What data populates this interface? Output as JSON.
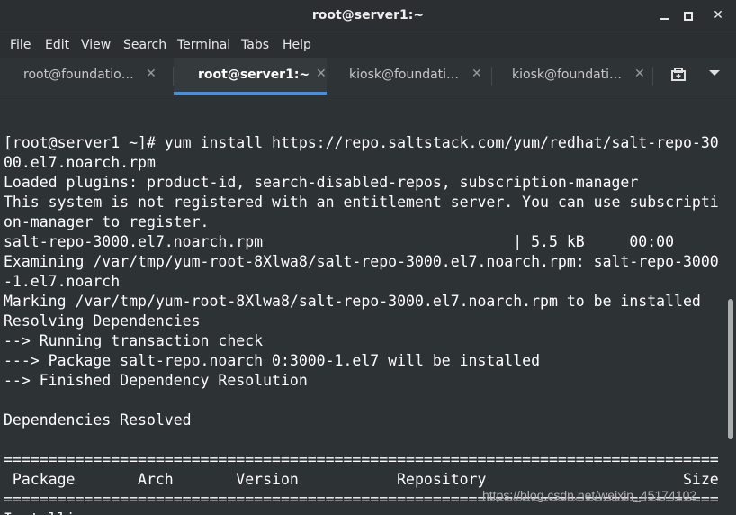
{
  "window": {
    "title": "root@server1:~",
    "controls": {
      "minimize_icon": "minimize-icon",
      "maximize_icon": "maximize-icon",
      "close_icon": "close-icon",
      "close_glyph": "✕"
    }
  },
  "menu": [
    "File",
    "Edit",
    "View",
    "Search",
    "Terminal",
    "Tabs",
    "Help"
  ],
  "tabs": [
    {
      "label": "root@foundatio…",
      "close": "✕",
      "active": false
    },
    {
      "label": "root@server1:~",
      "close": "✕",
      "active": true
    },
    {
      "label": "kiosk@foundati…",
      "close": "✕",
      "active": false
    },
    {
      "label": "kiosk@foundati…",
      "close": "✕",
      "active": false
    }
  ],
  "tab_actions": {
    "new_tab_icon": "new-tab-icon",
    "dropdown_icon": "chevron-down-icon"
  },
  "terminal": {
    "lines": [
      "[root@server1 ~]# yum install https://repo.saltstack.com/yum/redhat/salt-repo-30",
      "00.el7.noarch.rpm",
      "Loaded plugins: product-id, search-disabled-repos, subscription-manager",
      "This system is not registered with an entitlement server. You can use subscripti",
      "on-manager to register.",
      "salt-repo-3000.el7.noarch.rpm                            | 5.5 kB     00:00",
      "Examining /var/tmp/yum-root-8Xlwa8/salt-repo-3000.el7.noarch.rpm: salt-repo-3000",
      "-1.el7.noarch",
      "Marking /var/tmp/yum-root-8Xlwa8/salt-repo-3000.el7.noarch.rpm to be installed",
      "Resolving Dependencies",
      "--> Running transaction check",
      "---> Package salt-repo.noarch 0:3000-1.el7 will be installed",
      "--> Finished Dependency Resolution",
      "",
      "Dependencies Resolved",
      "",
      "================================================================================",
      " Package       Arch       Version           Repository                      Size",
      "================================================================================",
      "Installing:"
    ]
  },
  "watermark": "https://blog.csdn.net/weixin_45174102",
  "colors": {
    "background": "#2d3235",
    "accent": "#4a90d9",
    "text": "#ffffff"
  }
}
